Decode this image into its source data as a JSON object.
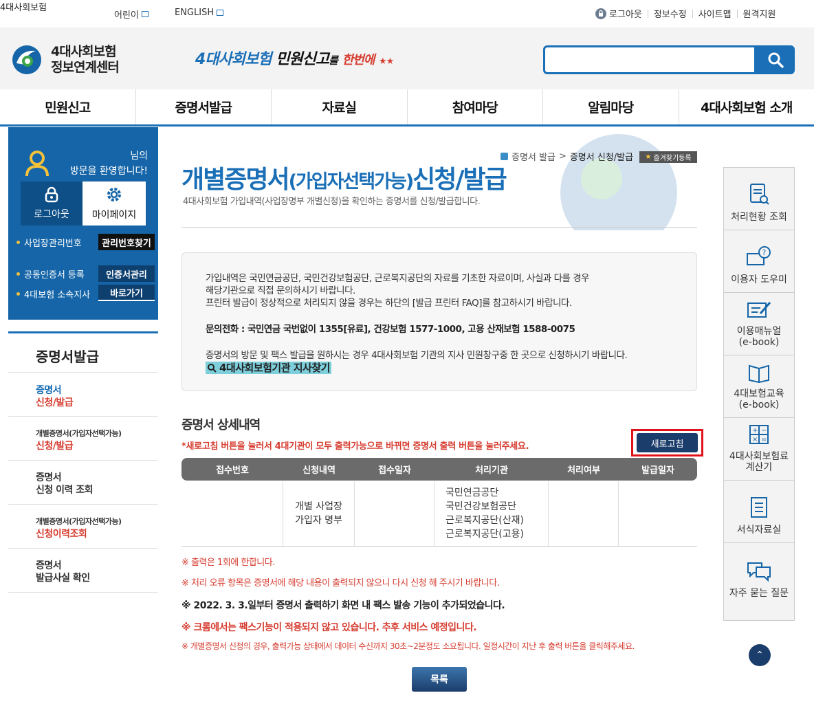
{
  "topbar": {
    "brand": "4대사회보험",
    "kids": "어린이",
    "english": "ENGLISH",
    "logout": "로그아웃",
    "edit_info": "정보수정",
    "sitemap": "사이트맵",
    "remote": "원격지원"
  },
  "header": {
    "logo_line1": "4대사회보험",
    "logo_line2": "정보연계센터",
    "slogan_part1": "4대사회보험",
    "slogan_part2": "민원신고",
    "slogan_part3": "를",
    "slogan_part4": "한번에",
    "search_placeholder": ""
  },
  "gnb": [
    "민원신고",
    "증명서발급",
    "자료실",
    "참여마당",
    "알림마당",
    "4대사회보험 소개"
  ],
  "login": {
    "suffix": "님의",
    "welcome": "방문을 환영합니다!",
    "logout": "로그아웃",
    "mypage": "마이페이지",
    "biz_no_label": "사업장관리번호",
    "biz_no_btn": "관리번호찾기",
    "cert_label": "공동인증서 등록",
    "cert_btn": "인증서관리",
    "branch_label": "4대보험 소속지사",
    "branch_btn": "바로가기"
  },
  "lnb": {
    "title": "증명서발급",
    "items": [
      {
        "a": "증명서",
        "b": "신청/발급"
      },
      {
        "a": "개별증명서(가입자선택가능)",
        "b": "신청/발급"
      },
      {
        "a": "증명서",
        "b": "신청 이력 조회"
      },
      {
        "a": "개별증명서(가입자선택가능)",
        "b": "신청이력조회"
      },
      {
        "a": "증명서",
        "b": "발급사실 확인"
      }
    ]
  },
  "quick": [
    "처리현황 조회",
    "이용자 도우미",
    "이용매뉴얼\n(e-book)",
    "4대보험교육\n(e-book)",
    "4대사회보험료\n계산기",
    "서식자료실",
    "자주 묻는 질문"
  ],
  "breadcrumb": {
    "level1": "증명서 발급",
    "level2": "증명서 신청/발급",
    "fav": "즐겨찾기등록"
  },
  "page": {
    "title_a": "개별증명서",
    "title_b": "(가입자선택가능)",
    "title_c": "신청/발급",
    "desc": "4대사회보험 가입내역(사업장명부 개별신청)을 확인하는 증명서를 신청/발급합니다."
  },
  "notice": {
    "line1": "가입내역은 국민연금공단, 국민건강보험공단, 근로복지공단의 자료를 기초한 자료이며, 사실과 다를 경우",
    "line2": "해당기관으로 직접 문의하시기 바랍니다.",
    "line3": "프린터 발급이 정상적으로 처리되지 않을 경우는 하단의 [발급 프린터 FAQ]를 참고하시기 바랍니다.",
    "phone": "문의전화 : 국민연금 국번없이 1355[유료], 건강보험 1577-1000, 고용 산재보험 1588-0075",
    "visit": "증명서의 방문 및 팩스 발급을 원하시는 경우 4대사회보험 기관의 지사 민원창구중 한 곳으로 신청하시기 바랍니다.",
    "branch_link": "4대사회보험기관 지사찾기"
  },
  "detail": {
    "title": "증명서 상세내역",
    "note": "*새로고침 버튼을 눌러서 4대기관이 모두 출력가능으로 바뀌면 증명서 출력 버튼을 눌러주세요.",
    "refresh": "새로고침",
    "columns": [
      "접수번호",
      "신청내역",
      "접수일자",
      "처리기관",
      "처리여부",
      "발급일자"
    ],
    "row": {
      "receipt_no": "",
      "request": "개별 사업장\n가입자 명부",
      "date": "",
      "agencies": [
        "국민연금공단",
        "국민건강보험공단",
        "근로복지공단(산재)",
        "근로복지공단(고용)"
      ],
      "status": "",
      "issue_date": ""
    }
  },
  "notes": {
    "n1": "※ 출력은 1회에 한합니다.",
    "n2": "※ 처리 오류 항목은 증명서에 해당 내용이 출력되지 않으니 다시 신청 해 주시기 바랍니다.",
    "n3": "※ 2022. 3. 3.일부터 증명서 출력하기 화면 내 팩스 발송 기능이 추가되었습니다.",
    "n4": "※ 크롬에서는 팩스기능이 적용되지 않고 있습니다. 추후 서비스 예정입니다.",
    "n5": "※ 개별증명서 신청의 경우, 출력가능 상태에서 데이터 수신까지 30초~2분정도 소요됩니다. 일정시간이 지난 후 출력 버튼을 클릭해주세요."
  },
  "list_button": "목록",
  "colors": {
    "primary": "#1565a8",
    "accent_red": "#d63c2f",
    "navy": "#1b3d6b",
    "highlight": "#e0131b"
  }
}
